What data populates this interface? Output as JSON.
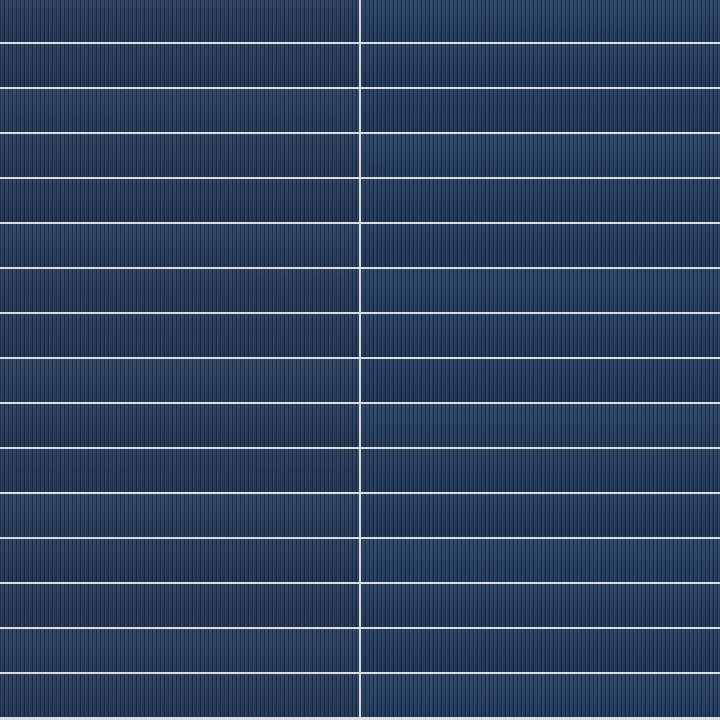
{
  "scene": {
    "subject": "fluted-blue-wall-tiles",
    "tile_color": "#243b5c",
    "grout_color": "#d9dde2",
    "columns": 2,
    "rows": 16
  }
}
